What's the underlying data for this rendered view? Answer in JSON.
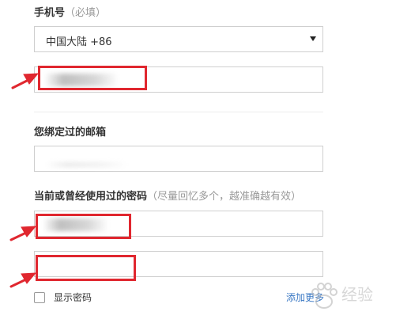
{
  "phone": {
    "label": "手机号",
    "hint": "（必填）",
    "country_selected": "中国大陆 +86"
  },
  "email": {
    "label": "您绑定过的邮箱"
  },
  "password": {
    "label": "当前或曾经使用过的密码",
    "hint": "（尽量回忆多个，越准确越有效）"
  },
  "show_password": {
    "label": "显示密码",
    "checked": false
  },
  "add_more": {
    "label": "添加更多"
  },
  "watermark": {
    "text": "经验",
    "icon": "baidu-paw-icon"
  },
  "colors": {
    "annotation_red": "#e0272f",
    "link_blue": "#3a78c4",
    "hint_gray": "#999999"
  }
}
